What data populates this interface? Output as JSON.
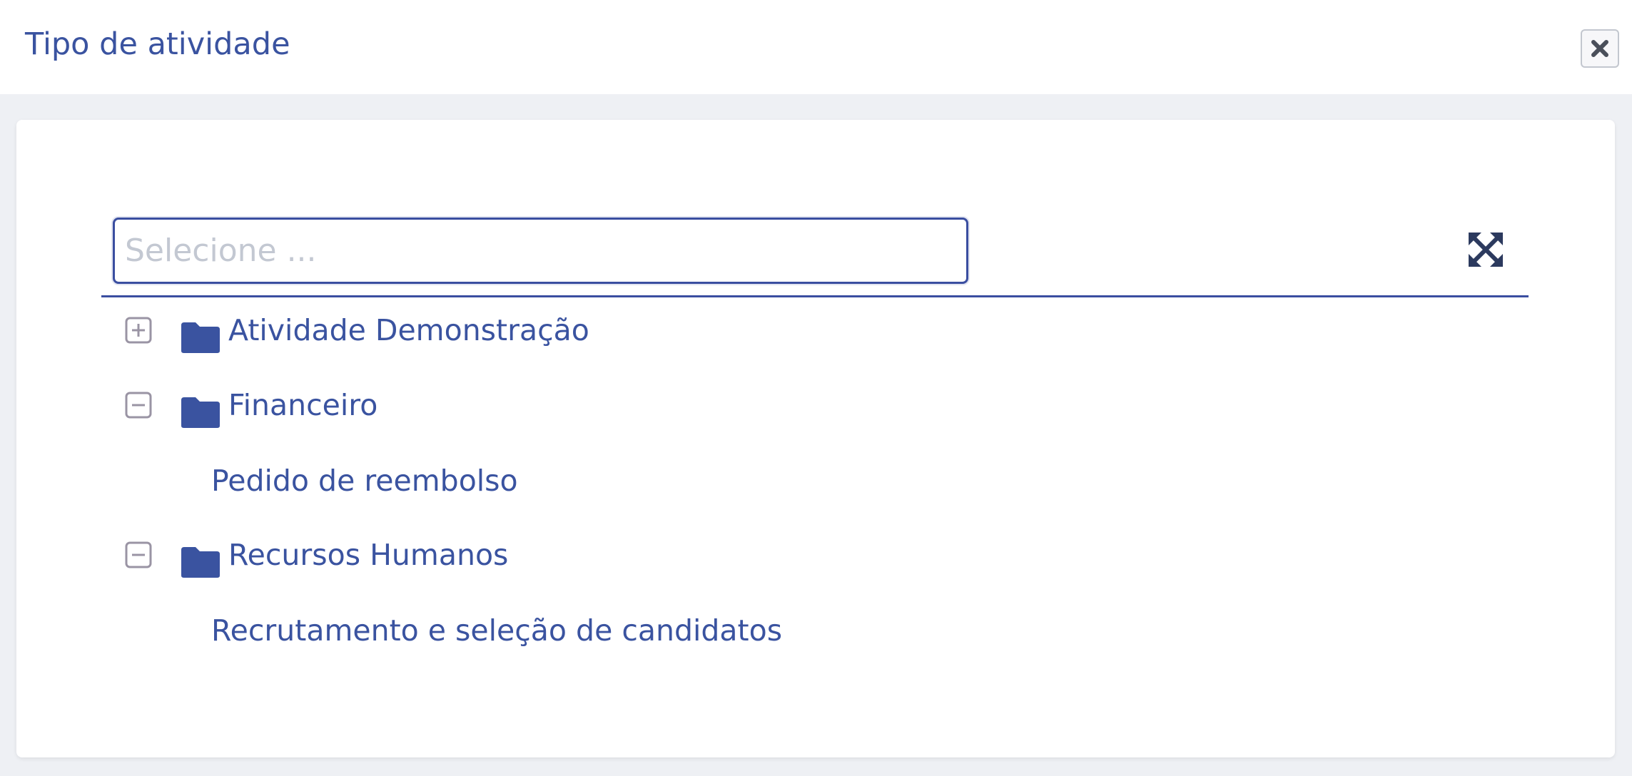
{
  "dialog": {
    "title": "Tipo de atividade"
  },
  "search": {
    "placeholder": "Selecione ...",
    "value": ""
  },
  "tree": {
    "nodes": [
      {
        "label": "Atividade Demonstração",
        "state": "collapsed"
      },
      {
        "label": "Financeiro",
        "state": "expanded",
        "children": [
          "Pedido de reembolso"
        ]
      },
      {
        "label": "Recursos Humanos",
        "state": "expanded",
        "children": [
          "Recrutamento e seleção de candidatos"
        ]
      }
    ]
  },
  "colors": {
    "accent": "#3a4ea0",
    "text": "#3a53a0",
    "background": "#eef0f4"
  }
}
